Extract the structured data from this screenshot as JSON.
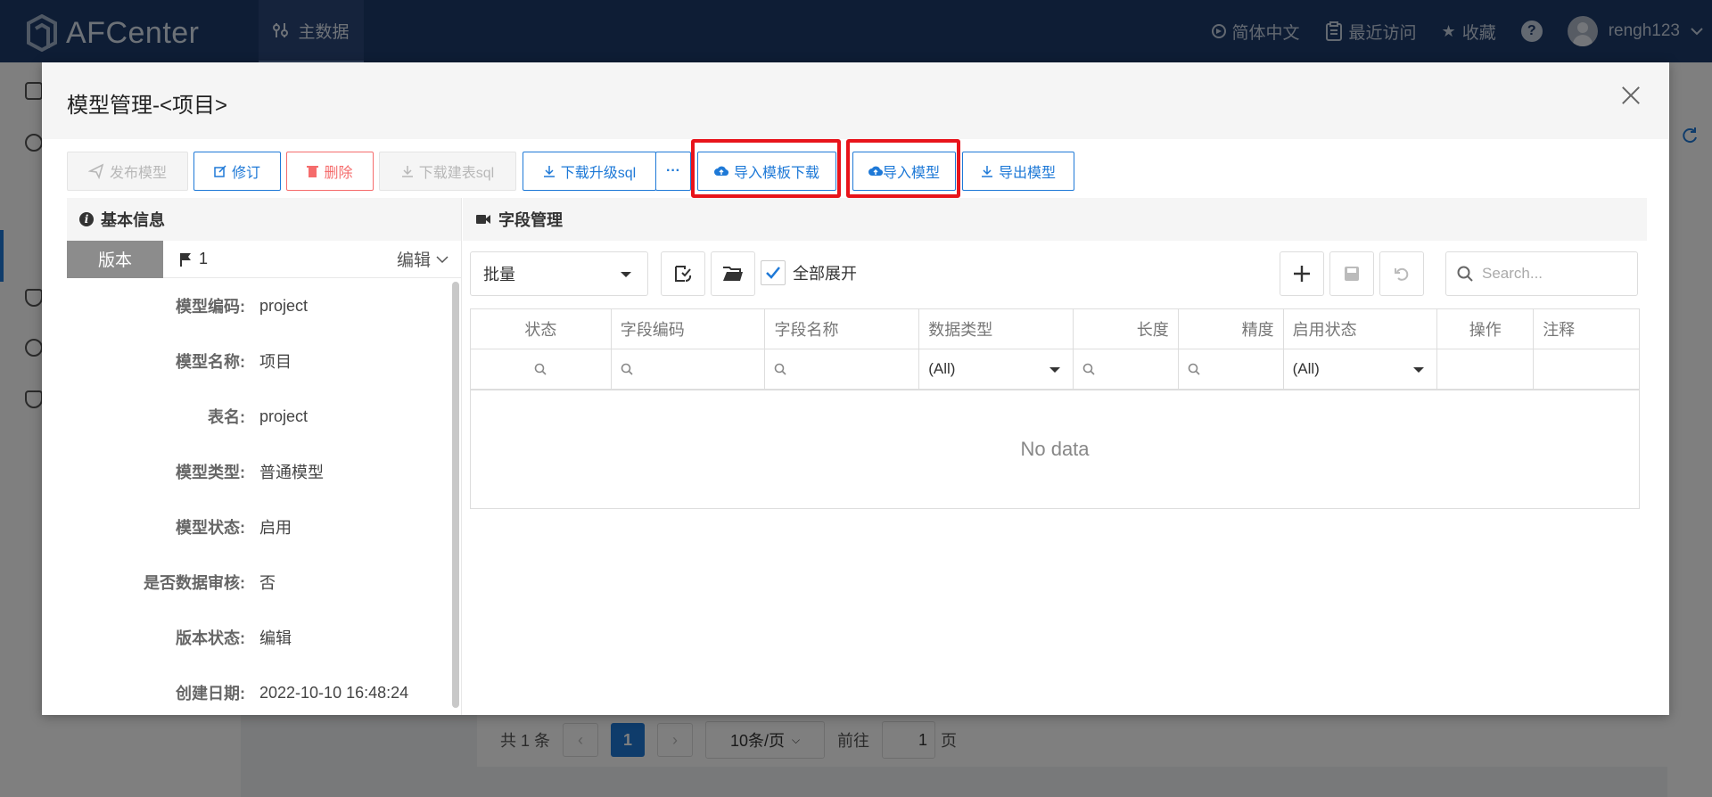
{
  "topbar": {
    "app_name": "AFCenter",
    "main_nav": "主数据",
    "language": "简体中文",
    "recent": "最近访问",
    "favorites": "收藏",
    "help": "?",
    "username": "rengh123"
  },
  "modal": {
    "title": "模型管理-<项目>",
    "toolbar": {
      "publish": "发布模型",
      "revise": "修订",
      "delete": "删除",
      "download_create_sql": "下载建表sql",
      "download_upgrade_sql": "下载升级sql",
      "more": "···",
      "import_template_download": "导入模板下载",
      "import_model": "导入模型",
      "export_model": "导出模型"
    },
    "basic_info": {
      "heading": "基本信息",
      "version_label": "版本",
      "version_value": "1",
      "edit_label": "编辑",
      "fields": [
        {
          "label": "模型编码:",
          "value": "project"
        },
        {
          "label": "模型名称:",
          "value": "项目"
        },
        {
          "label": "表名:",
          "value": "project"
        },
        {
          "label": "模型类型:",
          "value": "普通模型"
        },
        {
          "label": "模型状态:",
          "value": "启用"
        },
        {
          "label": "是否数据审核:",
          "value": "否"
        },
        {
          "label": "版本状态:",
          "value": "编辑"
        },
        {
          "label": "创建日期:",
          "value": "2022-10-10 16:48:24"
        }
      ]
    },
    "field_mgmt": {
      "heading": "字段管理",
      "batch_select": "批量",
      "expand_all": "全部展开",
      "search_placeholder": "Search...",
      "columns": [
        "状态",
        "字段编码",
        "字段名称",
        "数据类型",
        "长度",
        "精度",
        "启用状态",
        "操作",
        "注释"
      ],
      "filter_all": "(All)",
      "no_data": "No data"
    }
  },
  "background_pager": {
    "total": "共 1 条",
    "current_page": "1",
    "page_size": "10条/页",
    "goto_label": "前往",
    "goto_value": "1",
    "page_unit": "页"
  },
  "colors": {
    "topbar": "#1d3a6b",
    "primary": "#1e79d7",
    "danger": "#f56c6c",
    "highlight": "#e8141b"
  }
}
